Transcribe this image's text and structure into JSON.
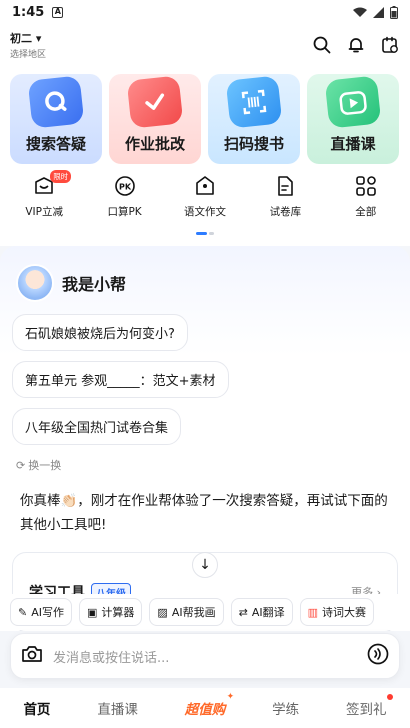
{
  "status": {
    "time": "1:45",
    "notif_letter": "A"
  },
  "header": {
    "grade": "初二",
    "region_hint": "选择地区"
  },
  "big_tools": [
    {
      "label": "搜索答疑"
    },
    {
      "label": "作业批改"
    },
    {
      "label": "扫码搜书"
    },
    {
      "label": "直播课"
    }
  ],
  "small_tools": [
    {
      "label": "VIP立减",
      "badge": "限时"
    },
    {
      "label": "口算PK",
      "icon_text": "PK"
    },
    {
      "label": "语文作文"
    },
    {
      "label": "试卷库"
    },
    {
      "label": "全部"
    }
  ],
  "chat": {
    "bot_name": "我是小帮",
    "suggestions": [
      "石矶娘娘被烧后为何变小?",
      "第五单元 参观_____：范文+素材",
      "八年级全国热门试卷合集"
    ],
    "refresh": "换一换",
    "message": "你真棒👏🏻，刚才在作业帮体验了一次搜索答疑，再试试下面的其他小工具吧!",
    "study_title": "学习工具",
    "study_grade": "八年级",
    "more": "更多"
  },
  "quick_tools": [
    "AI写作",
    "计算器",
    "AI帮我画",
    "AI翻译",
    "诗词大赛"
  ],
  "input": {
    "placeholder": "发消息或按住说话..."
  },
  "tabs": [
    "首页",
    "直播课",
    "超值购",
    "学练",
    "签到礼"
  ],
  "colors": {
    "accent": "#2d7cff",
    "hot": "#ff6a2a",
    "red": "#ff3b30"
  }
}
